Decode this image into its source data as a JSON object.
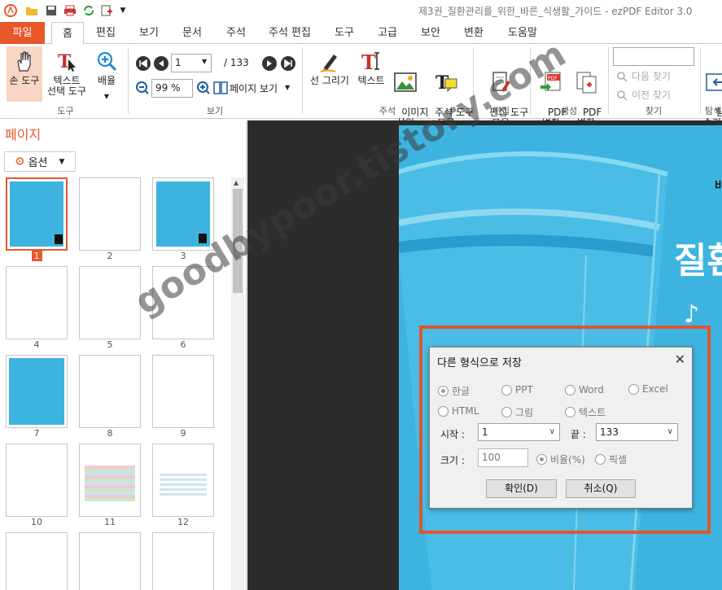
{
  "window": {
    "title": "제3권_질환관리를_위한_바른_식생활_가이드 - ezPDF Editor 3.0"
  },
  "menu": {
    "file": "파일",
    "tabs": [
      "홈",
      "편집",
      "보기",
      "문서",
      "주석",
      "주석 편집",
      "도구",
      "고급",
      "보안",
      "변환",
      "도움말"
    ]
  },
  "ribbon": {
    "hand_tool": "손 도구",
    "text_select_tool": "텍스트\n선택 도구",
    "zoom": "배율",
    "tools_group": "도구",
    "page_current": "1",
    "page_total": "/ 133",
    "zoom_value": "99 %",
    "page_view": "페이지 보기",
    "view_group": "보기",
    "draw_line": "선 그리기",
    "text": "텍스트",
    "insert_image": "이미지\n삽입",
    "annotation_tools": "주석 도구\n모음",
    "annotation_group": "주석",
    "edit_tools": "편집 도구\n모음",
    "edit_group": "편집",
    "pdf_convert": "PDF\n변환",
    "pdf_merge": "PDF\n병합",
    "create_group": "생성",
    "find_next": "다음 찾기",
    "find_prev": "이전 찾기",
    "find_group": "찾기",
    "explorer_partial": "탐색\n숨기",
    "explorer_group_partial": "탐색"
  },
  "pages_panel": {
    "title": "페이지",
    "options": "옵션",
    "thumbnails": [
      "1",
      "2",
      "3",
      "4",
      "5",
      "6",
      "7",
      "8",
      "9",
      "10",
      "11",
      "12"
    ]
  },
  "document": {
    "heading_partial": "질환",
    "corner_text": "바"
  },
  "dialog": {
    "title": "다른 형식으로 저장",
    "close": "✕",
    "formats": [
      "한글",
      "PPT",
      "Word",
      "Excel",
      "HTML",
      "그림",
      "텍스트"
    ],
    "selected_format": "한글",
    "start_label": "시작 :",
    "start_value": "1",
    "end_label": "끝 :",
    "end_value": "133",
    "size_label": "크기 :",
    "size_value": "100",
    "ratio_option": "비율(%)",
    "pixel_option": "픽셀",
    "ok": "확인(D)",
    "cancel": "취소(Q)"
  },
  "watermark": "goodbypoor.tistory.com",
  "colors": {
    "accent": "#e8572a",
    "doc_blue": "#3db4e0",
    "highlight": "#e0552d"
  }
}
